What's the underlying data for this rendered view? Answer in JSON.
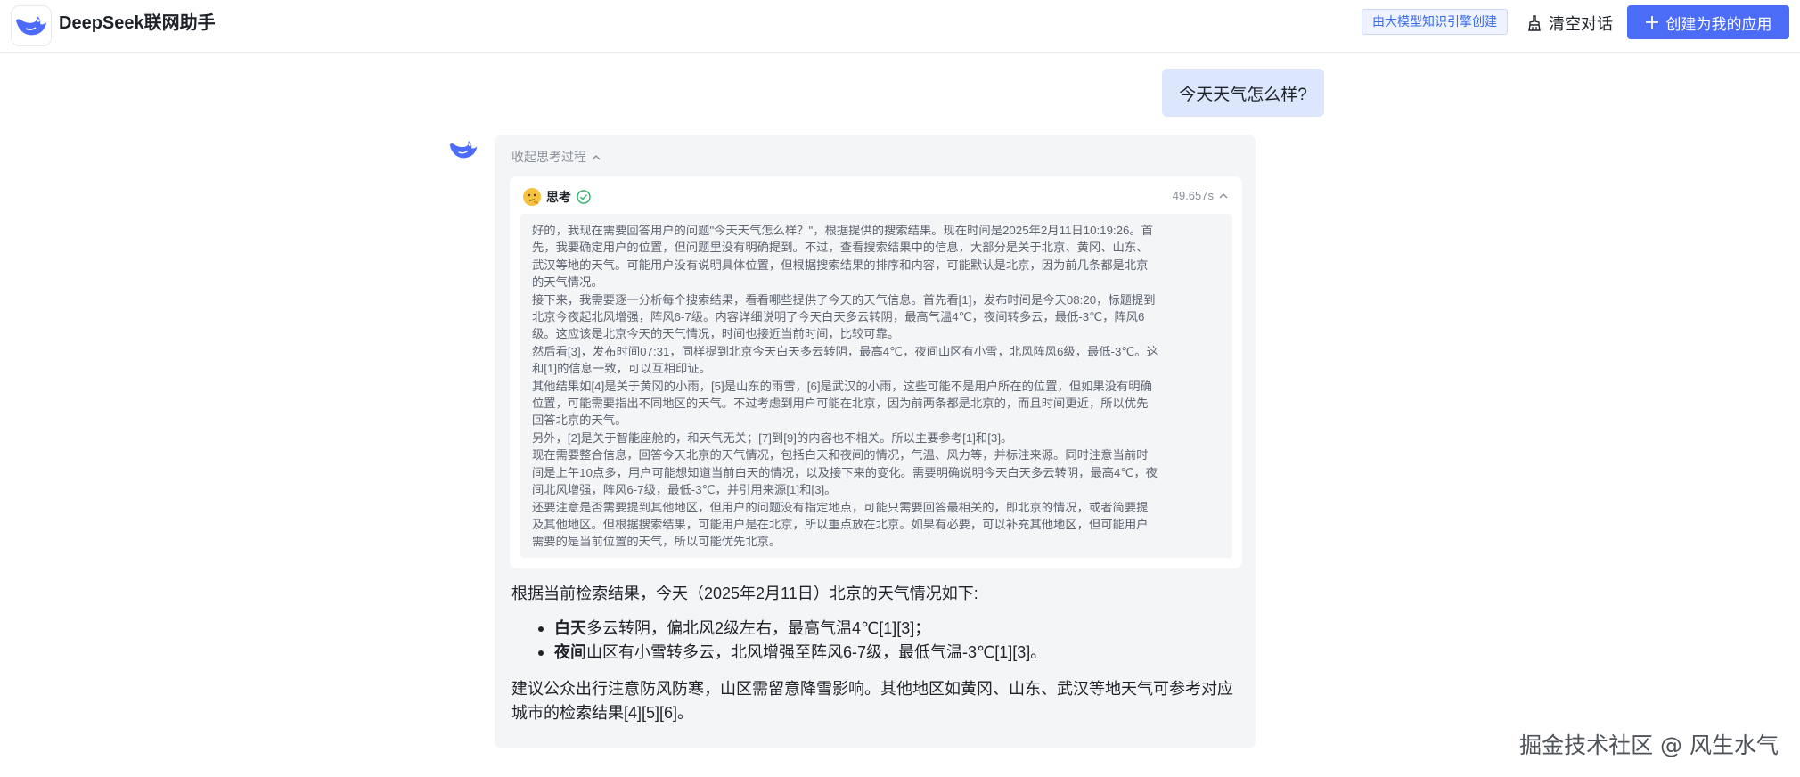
{
  "header": {
    "app_title": "DeepSeek联网助手",
    "kb_badge": "由大模型知识引擎创建",
    "clear_label": "清空对话",
    "create_label": "创建为我的应用",
    "accent_color": "#4a6cf7"
  },
  "chat": {
    "user_message": "今天天气怎么样?",
    "collapse_label": "收起思考过程",
    "think_title": "思考",
    "think_time": "49.657s",
    "think_lines": [
      "好的，我现在需要回答用户的问题\"今天天气怎么样？\"，根据提供的搜索结果。现在时间是2025年2月11日10:19:26。首",
      "先，我要确定用户的位置，但问题里没有明确提到。不过，查看搜索结果中的信息，大部分是关于北京、黄冈、山东、",
      "武汉等地的天气。可能用户没有说明具体位置，但根据搜索结果的排序和内容，可能默认是北京，因为前几条都是北京",
      "的天气情况。",
      "接下来，我需要逐一分析每个搜索结果，看看哪些提供了今天的天气信息。首先看[1]，发布时间是今天08:20，标题提到",
      "北京今夜起北风增强，阵风6-7级。内容详细说明了今天白天多云转阴，最高气温4℃，夜间转多云，最低-3℃，阵风6",
      "级。这应该是北京今天的天气情况，时间也接近当前时间，比较可靠。",
      "然后看[3]，发布时间07:31，同样提到北京今天白天多云转阴，最高4℃，夜间山区有小雪，北风阵风6级，最低-3℃。这",
      "和[1]的信息一致，可以互相印证。",
      "其他结果如[4]是关于黄冈的小雨，[5]是山东的雨雪，[6]是武汉的小雨，这些可能不是用户所在的位置，但如果没有明确",
      "位置，可能需要指出不同地区的天气。不过考虑到用户可能在北京，因为前两条都是北京的，而且时间更近，所以优先",
      "回答北京的天气。",
      "另外，[2]是关于智能座舱的，和天气无关；[7]到[9]的内容也不相关。所以主要参考[1]和[3]。",
      "现在需要整合信息，回答今天北京的天气情况，包括白天和夜间的情况，气温、风力等，并标注来源。同时注意当前时",
      "间是上午10点多，用户可能想知道当前白天的情况，以及接下来的变化。需要明确说明今天白天多云转阴，最高4℃，夜",
      "间北风增强，阵风6-7级，最低-3℃，并引用来源[1]和[3]。",
      "还要注意是否需要提到其他地区，但用户的问题没有指定地点，可能只需要回答最相关的，即北京的情况，或者简要提",
      "及其他地区。但根据搜索结果，可能用户是在北京，所以重点放在北京。如果有必要，可以补充其他地区，但可能用户",
      "需要的是当前位置的天气，所以可能优先北京。"
    ],
    "answer": {
      "intro": "根据当前检索结果，今天（2025年2月11日）北京的天气情况如下:",
      "items": [
        {
          "label": "白天",
          "text": "多云转阴，偏北风2级左右，最高气温4℃[1][3]；"
        },
        {
          "label": "夜间",
          "text": "山区有小雪转多云，北风增强至阵风6-7级，最低气温-3℃[1][3]。"
        }
      ],
      "conclusion_line1": "建议公众出行注意防风防寒，山区需留意降雪影响。其他地区如黄冈、山东、武汉等地天气可参考对应",
      "conclusion_line2": "城市的检索结果[4][5][6]。"
    }
  },
  "watermark": "掘金技术社区 @ 风生水气"
}
